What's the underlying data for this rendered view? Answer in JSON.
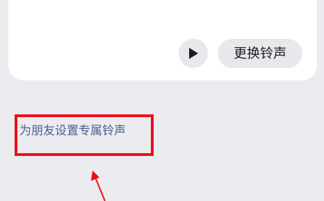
{
  "ringtone_card": {
    "play_icon": "play-icon",
    "change_ringtone_label": "更换铃声"
  },
  "friend_ringtone": {
    "label": "为朋友设置专属铃声"
  },
  "annotation": {
    "highlight_color": "#e8101a",
    "arrow_color": "#e8101a"
  },
  "colors": {
    "background": "#ecebf0",
    "card": "#ffffff",
    "pill": "#e8e8ec",
    "link": "#4b5e8f"
  }
}
